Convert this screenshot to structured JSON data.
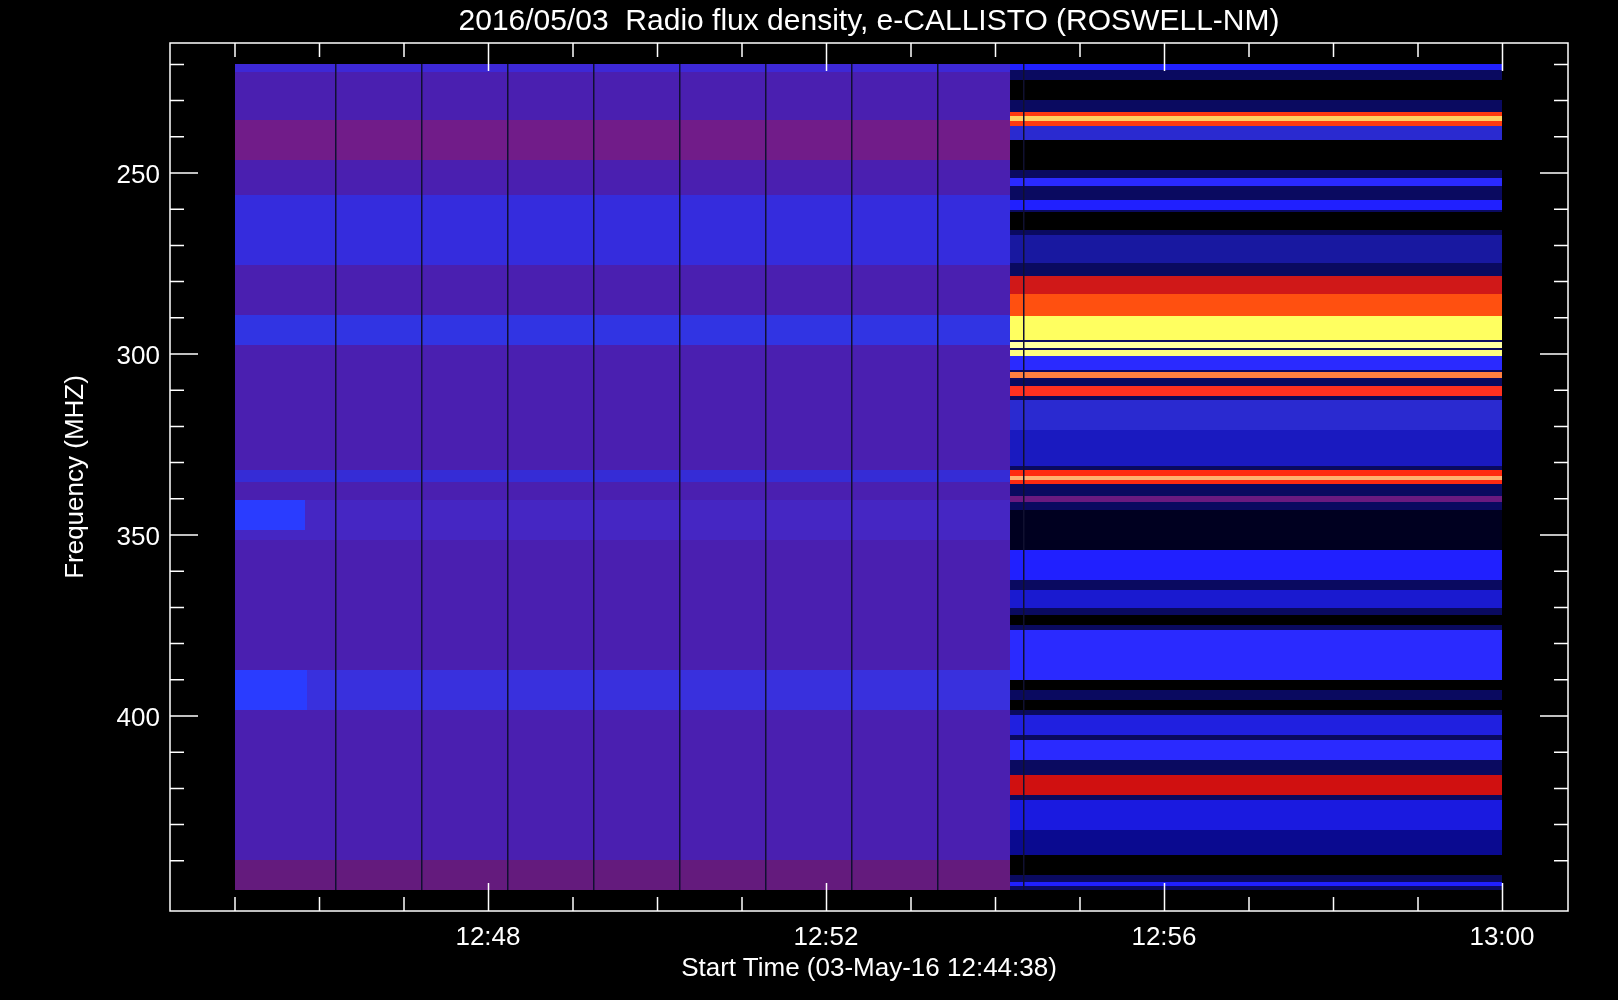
{
  "title": "2016/05/03  Radio flux density, e-CALLISTO (ROSWELL-NM)",
  "ylabel": "Frequency (MHZ)",
  "xlabel": "Start Time (03-May-16 12:44:38)",
  "yticks": [
    "250",
    "300",
    "350",
    "400"
  ],
  "xticks": [
    "12:48",
    "12:52",
    "12:56",
    "13:00"
  ]
}
